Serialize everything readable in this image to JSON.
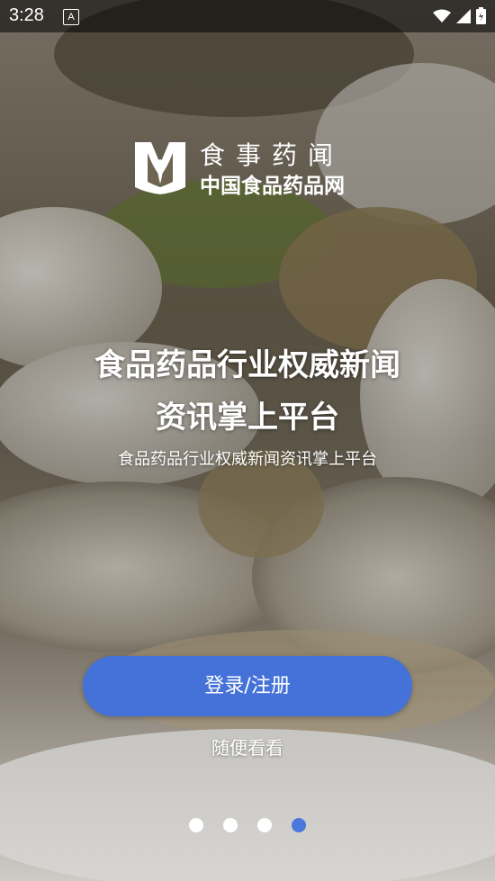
{
  "statusbar": {
    "time": "3:28",
    "notif_badge": "A"
  },
  "logo": {
    "title": "食事药闻",
    "subtitle": "中国食品药品网",
    "mark_icon": "brand-logo-icon"
  },
  "hero": {
    "headline_line1": "食品药品行业权威新闻",
    "headline_line2": "资讯掌上平台",
    "subheadline": "食品药品行业权威新闻资讯掌上平台"
  },
  "actions": {
    "login_label": "登录/注册",
    "browse_label": "随便看看"
  },
  "pager": {
    "total": 4,
    "active_index": 3
  },
  "colors": {
    "primary_button": "#4472d8",
    "active_dot": "#4a78db"
  }
}
